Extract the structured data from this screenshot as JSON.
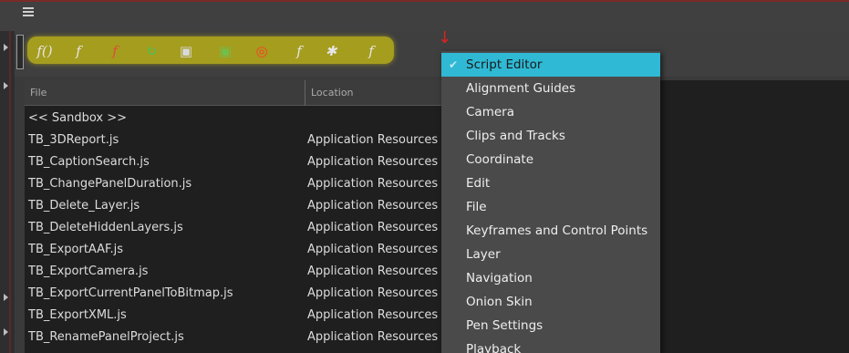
{
  "toolbar": {
    "tools": [
      {
        "icon": "run-function-icon",
        "glyph": "f()",
        "color": "#e6e6e6"
      },
      {
        "icon": "function-arrow-icon",
        "glyph": "f",
        "color": "#e6e6e6"
      },
      {
        "icon": "function-red-icon",
        "glyph": "f",
        "color": "#e24b3a"
      },
      {
        "icon": "refresh-icon",
        "glyph": "↻",
        "color": "#3fc45a"
      },
      {
        "icon": "import-script-icon",
        "glyph": "▣",
        "color": "#d9d9d9"
      },
      {
        "icon": "export-script-icon",
        "glyph": "▣",
        "color": "#6fbf4b"
      },
      {
        "icon": "target-icon",
        "glyph": "◎",
        "color": "#ff3b2a"
      },
      {
        "icon": "function-settings-icon",
        "glyph": "f",
        "color": "#e6e6e6"
      },
      {
        "icon": "debug-bug-icon",
        "glyph": "✱",
        "color": "#e6e6e6"
      },
      {
        "icon": "function-stop-icon",
        "glyph": "f",
        "color": "#e6e6e6"
      }
    ]
  },
  "table": {
    "headers": {
      "file": "File",
      "location": "Location"
    },
    "rows": [
      {
        "file": "<< Sandbox >>",
        "location": ""
      },
      {
        "file": "TB_3DReport.js",
        "location": "Application Resources"
      },
      {
        "file": "TB_CaptionSearch.js",
        "location": "Application Resources"
      },
      {
        "file": "TB_ChangePanelDuration.js",
        "location": "Application Resources"
      },
      {
        "file": "TB_Delete_Layer.js",
        "location": "Application Resources"
      },
      {
        "file": "TB_DeleteHiddenLayers.js",
        "location": "Application Resources"
      },
      {
        "file": "TB_ExportAAF.js",
        "location": "Application Resources"
      },
      {
        "file": "TB_ExportCamera.js",
        "location": "Application Resources"
      },
      {
        "file": "TB_ExportCurrentPanelToBitmap.js",
        "location": "Application Resources"
      },
      {
        "file": "TB_ExportXML.js",
        "location": "Application Resources"
      },
      {
        "file": "TB_RenamePanelProject.js",
        "location": "Application Resources"
      }
    ]
  },
  "menu": {
    "items": [
      {
        "label": "Script Editor",
        "checked": true,
        "selected": true
      },
      {
        "label": "Alignment Guides"
      },
      {
        "label": "Camera"
      },
      {
        "label": "Clips and Tracks"
      },
      {
        "label": "Coordinate"
      },
      {
        "label": "Edit"
      },
      {
        "label": "File"
      },
      {
        "label": "Keyframes and Control Points"
      },
      {
        "label": "Layer"
      },
      {
        "label": "Navigation"
      },
      {
        "label": "Onion Skin"
      },
      {
        "label": "Pen Settings"
      },
      {
        "label": "Playback"
      }
    ]
  },
  "colors": {
    "menu_highlight": "#2fb9d4",
    "toolbar_highlight": "#c8be14",
    "annotation_arrow": "#dd2222"
  }
}
